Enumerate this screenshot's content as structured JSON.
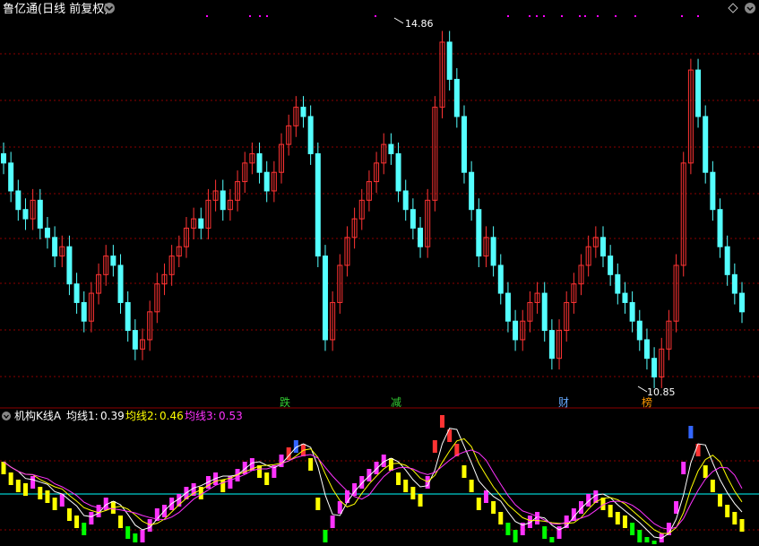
{
  "header": {
    "title": "鲁亿通(日线 前复权)",
    "dropdown_icon": "chevron-down-icon",
    "top_right_icons": [
      "diamond-icon",
      "settings-icon"
    ]
  },
  "main_panel": {
    "max_price_label": "14.86",
    "min_price_label": "10.85",
    "markers": [
      {
        "label": "跌",
        "color": "#33cc33"
      },
      {
        "label": "减",
        "color": "#33cc33"
      },
      {
        "label": "财",
        "color": "#66aaff"
      },
      {
        "label": "榜",
        "color": "#ff9900"
      }
    ],
    "colors": {
      "up": "#ff3333",
      "down": "#54ffff",
      "grid": "#8b0000",
      "magenta_dots": "#ff00ff"
    }
  },
  "indicator_panel": {
    "name": "机构K线A",
    "ma1": {
      "label": "均线1:",
      "value": "0.39",
      "color": "#ffffff"
    },
    "ma2": {
      "label": "均线2:",
      "value": "0.46",
      "color": "#ffff00"
    },
    "ma3": {
      "label": "均线3:",
      "value": "0.53",
      "color": "#ff33ff"
    },
    "baseline_color": "#00ffff"
  },
  "chart_data": {
    "type": "candlestick",
    "y_max": 14.86,
    "y_min": 10.85,
    "close": [
      13.3,
      13.0,
      12.8,
      12.7,
      12.9,
      12.6,
      12.5,
      12.3,
      12.4,
      12.0,
      11.8,
      11.6,
      11.9,
      12.1,
      12.3,
      12.2,
      11.8,
      11.5,
      11.3,
      11.4,
      11.7,
      12.0,
      12.1,
      12.3,
      12.4,
      12.6,
      12.7,
      12.6,
      12.9,
      13.0,
      12.8,
      12.9,
      13.1,
      13.3,
      13.4,
      13.2,
      13.0,
      13.2,
      13.5,
      13.7,
      13.9,
      13.8,
      13.4,
      12.3,
      11.4,
      11.8,
      12.2,
      12.5,
      12.7,
      12.9,
      13.1,
      13.3,
      13.5,
      13.4,
      13.0,
      12.8,
      12.6,
      12.4,
      12.9,
      13.9,
      14.6,
      14.2,
      13.8,
      13.2,
      12.8,
      12.3,
      12.5,
      12.2,
      11.9,
      11.6,
      11.4,
      11.6,
      11.8,
      11.9,
      11.5,
      11.2,
      11.5,
      11.8,
      12.0,
      12.2,
      12.4,
      12.5,
      12.3,
      12.1,
      11.9,
      11.8,
      11.6,
      11.4,
      11.2,
      11.0,
      11.3,
      11.6,
      12.2,
      13.3,
      14.3,
      13.8,
      13.2,
      12.8,
      12.4,
      12.1,
      11.9,
      11.7
    ]
  }
}
